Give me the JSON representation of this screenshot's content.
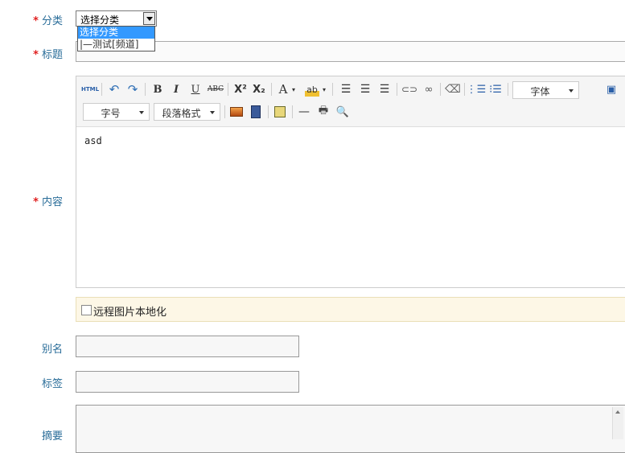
{
  "form": {
    "category_label": "分类",
    "title_label": "标题",
    "content_label": "内容",
    "alias_label": "别名",
    "tags_label": "标签",
    "summary_label": "摘要",
    "required_mark": "*"
  },
  "category": {
    "selected": "选择分类",
    "options": [
      "选择分类",
      "|—测试[频道]"
    ]
  },
  "title": {
    "value": ""
  },
  "editor": {
    "content": "asd",
    "font_label": "字体",
    "size_label": "字号",
    "format_label": "段落格式",
    "html_label": "HTML",
    "bold": "B",
    "italic": "I",
    "underline": "U",
    "strike": "ABC",
    "superscript": "X²",
    "subscript": "X₂",
    "fontcolor": "A",
    "highlight": "ab"
  },
  "remote_images": {
    "label": "远程图片本地化",
    "checked": false
  },
  "alias": {
    "value": ""
  },
  "tags": {
    "value": ""
  },
  "summary": {
    "value": ""
  }
}
